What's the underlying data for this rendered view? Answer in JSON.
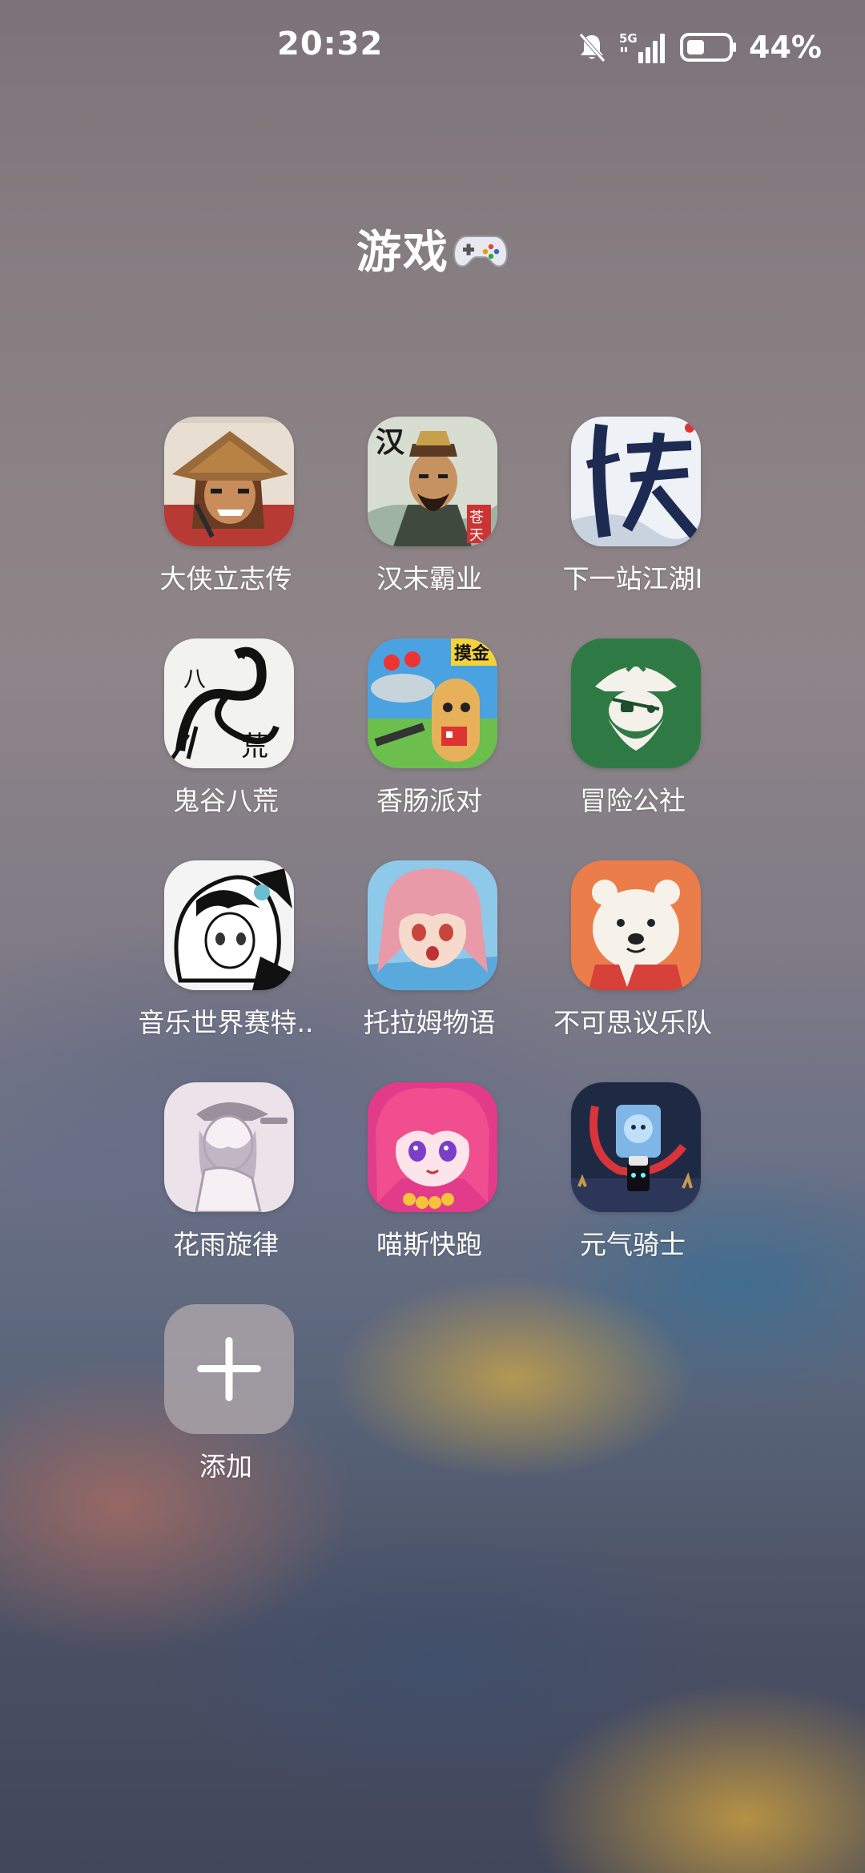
{
  "status_bar": {
    "time": "20:32",
    "network": "5G",
    "battery_percent": "44%",
    "battery_level": 0.44,
    "icons": [
      "notifications-muted-icon",
      "signal-5g-icon",
      "battery-icon"
    ]
  },
  "folder": {
    "title": "游戏",
    "title_icon": "gamepad-icon"
  },
  "apps": [
    {
      "label": "大侠立志传",
      "icon": "wandering-swordsman-icon"
    },
    {
      "label": "汉末霸业",
      "icon": "han-warlord-icon"
    },
    {
      "label": "下一站江湖Ⅰ",
      "icon": "xia-calligraphy-icon"
    },
    {
      "label": "鬼谷八荒",
      "icon": "ink-dragon-icon"
    },
    {
      "label": "香肠派对",
      "icon": "sausage-party-icon",
      "badge": "摸金"
    },
    {
      "label": "冒险公社",
      "icon": "pirate-captain-icon"
    },
    {
      "label": "音乐世界赛特..",
      "icon": "anime-girl-sketch-icon"
    },
    {
      "label": "托拉姆物语",
      "icon": "pink-hair-anime-icon"
    },
    {
      "label": "不可思议乐队",
      "icon": "polar-bear-icon"
    },
    {
      "label": "花雨旋律",
      "icon": "girl-in-cap-icon"
    },
    {
      "label": "喵斯快跑",
      "icon": "magenta-anime-girl-icon"
    },
    {
      "label": "元气骑士",
      "icon": "soul-knight-icon"
    }
  ],
  "add_button": {
    "label": "添加",
    "icon": "plus-icon"
  }
}
